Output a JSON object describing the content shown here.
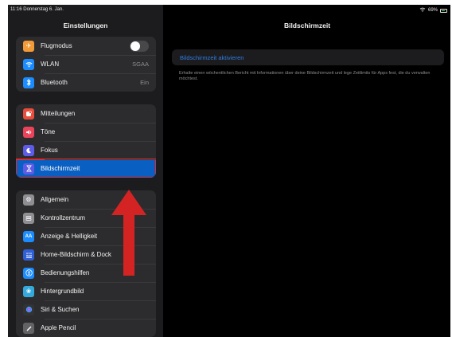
{
  "status": {
    "time_date": "11:16  Donnerstag 6. Jan.",
    "battery": "69%"
  },
  "sidebar": {
    "title": "Einstellungen",
    "group1": [
      {
        "label": "Flugmodus",
        "icon": "airplane-icon",
        "color": "#f19a37"
      },
      {
        "label": "WLAN",
        "value": "SGAA",
        "icon": "wifi-icon",
        "color": "#1a8cff"
      },
      {
        "label": "Bluetooth",
        "value": "Ein",
        "icon": "bluetooth-icon",
        "color": "#1a8cff"
      }
    ],
    "group2": [
      {
        "label": "Mitteilungen",
        "icon": "notifications-icon",
        "color": "#eb4d3d"
      },
      {
        "label": "Töne",
        "icon": "sound-icon",
        "color": "#eb445a"
      },
      {
        "label": "Fokus",
        "icon": "moon-icon",
        "color": "#5e5ce6"
      },
      {
        "label": "Bildschirmzeit",
        "icon": "hourglass-icon",
        "color": "#5e5ce6",
        "selected": true
      }
    ],
    "group3": [
      {
        "label": "Allgemein",
        "icon": "gear-icon",
        "color": "#8e8e93"
      },
      {
        "label": "Kontrollzentrum",
        "icon": "control-center-icon",
        "color": "#8e8e93"
      },
      {
        "label": "Anzeige & Helligkeit",
        "icon": "display-icon",
        "color": "#1a8cff"
      },
      {
        "label": "Home-Bildschirm & Dock",
        "icon": "home-screen-icon",
        "color": "#2f5fd7"
      },
      {
        "label": "Bedienungshilfen",
        "icon": "accessibility-icon",
        "color": "#1a8cff"
      },
      {
        "label": "Hintergrundbild",
        "icon": "wallpaper-icon",
        "color": "#34aadc"
      },
      {
        "label": "Siri & Suchen",
        "icon": "siri-icon",
        "color": "#333333"
      },
      {
        "label": "Apple Pencil",
        "icon": "pencil-icon",
        "color": "#636366"
      }
    ]
  },
  "detail": {
    "title": "Bildschirmzeit",
    "activate_label": "Bildschirmzeit aktivieren",
    "description": "Erhalte einen wöchentlichen Bericht mit Informationen über deine Bildschirmzeit und lege Zeitlimits für Apps fest, die du verwalten möchtest."
  },
  "colors": {
    "accent": "#0a5fc2",
    "highlight_border": "#e12a2a",
    "arrow": "#d42323"
  }
}
